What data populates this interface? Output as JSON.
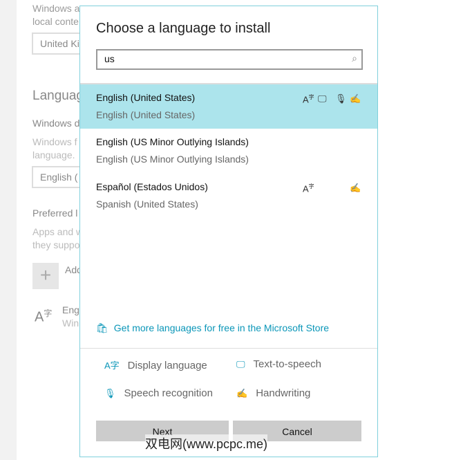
{
  "background": {
    "line1": "Windows a",
    "line2": "local conte",
    "region_value": "United Ki",
    "heading": "Languag",
    "windows_display": "Windows d",
    "windows_desc1": "Windows f",
    "windows_desc2": "language.",
    "display_value": "English (",
    "preferred": "Preferred l",
    "apps1": "Apps and w",
    "apps2": "they suppo",
    "add_label": "Add",
    "lang_name": "Eng",
    "lang_sub": "Win"
  },
  "dialog": {
    "title": "Choose a language to install",
    "search_value": "us",
    "items": [
      {
        "name": "English (United States)",
        "sub": "English (United States)",
        "selected": true
      },
      {
        "name": "English (US Minor Outlying Islands)",
        "sub": "English (US Minor Outlying Islands)"
      },
      {
        "name": "Español (Estados Unidos)",
        "sub": "Spanish (United States)"
      }
    ],
    "store_link": "Get more languages for free in the Microsoft Store",
    "legend": {
      "display": "Display language",
      "tts": "Text-to-speech",
      "speech": "Speech recognition",
      "handwriting": "Handwriting"
    },
    "next": "Next",
    "cancel": "Cancel"
  },
  "watermark": "双电网(www.pcpc.me)",
  "colors": {
    "accent": "#0a96b8",
    "selected": "#ace4ec"
  }
}
